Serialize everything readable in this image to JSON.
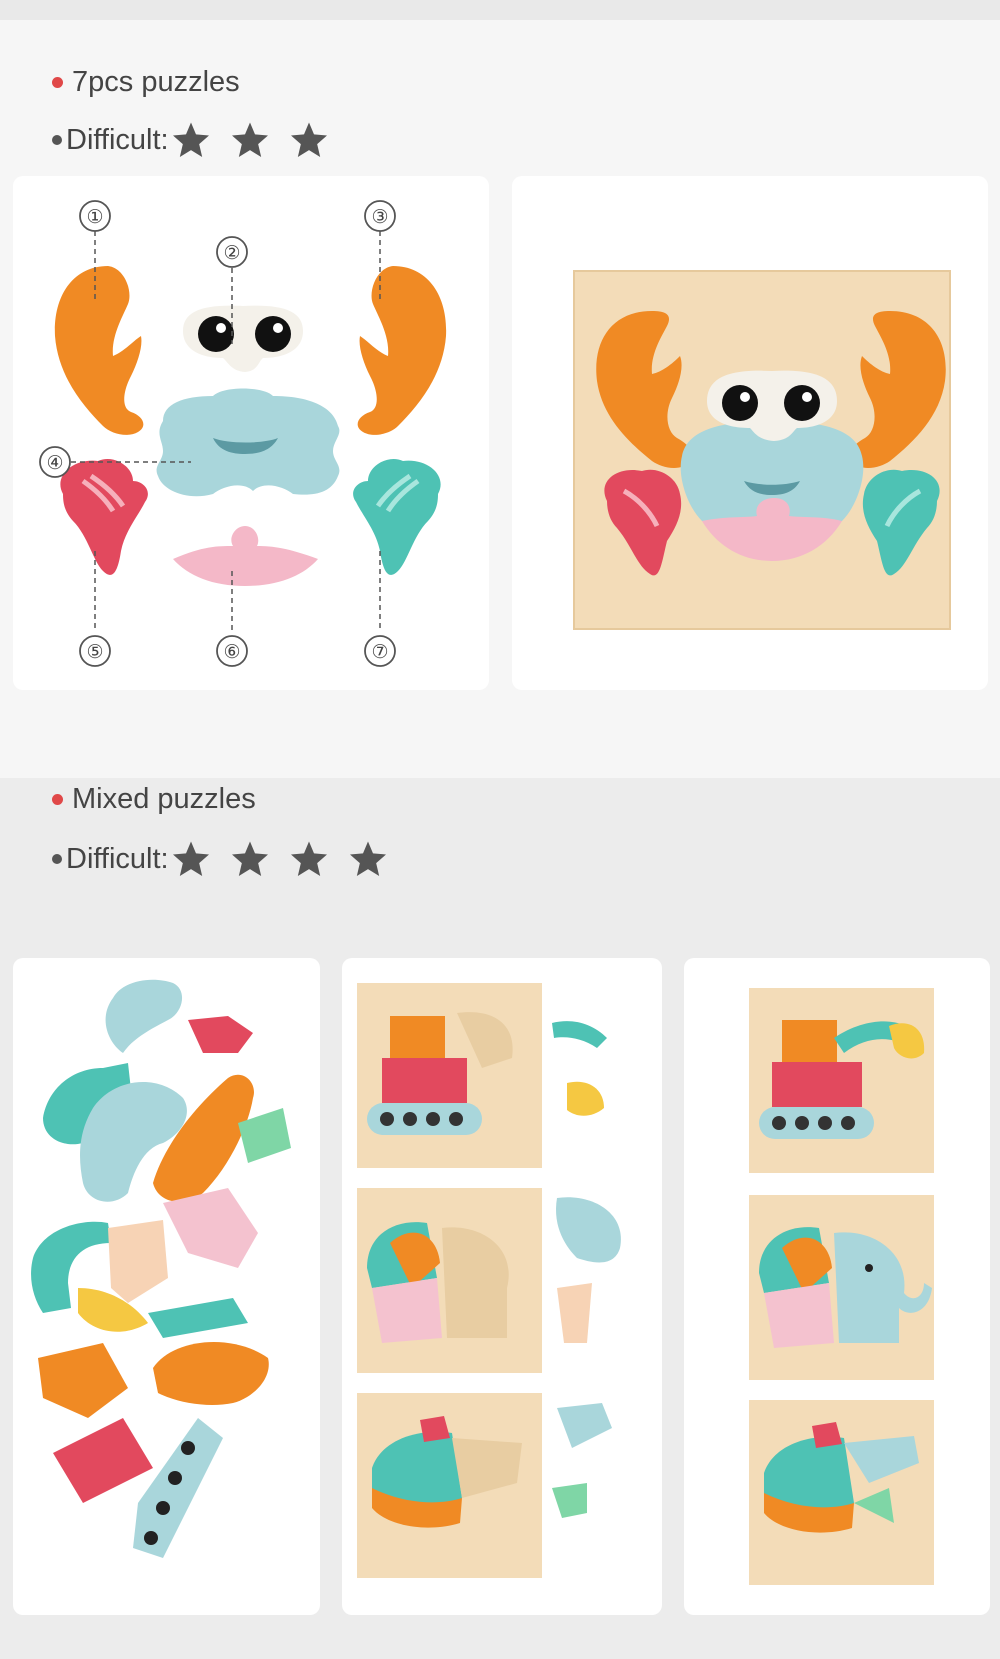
{
  "section1": {
    "title": "7pcs puzzles",
    "difficulty_label": "Difficult:",
    "difficulty_stars": 3,
    "callouts": [
      "①",
      "②",
      "③",
      "④",
      "⑤",
      "⑥",
      "⑦"
    ]
  },
  "section2": {
    "title": "Mixed puzzles",
    "difficulty_label": "Difficult:",
    "difficulty_stars": 4
  },
  "colors": {
    "orange": "#f08a24",
    "blue": "#a9d6db",
    "pink": "#f4b8c8",
    "red": "#e2495e",
    "teal": "#4ec2b4",
    "wood": "#f3dcb8",
    "bullet": "#e04848"
  }
}
